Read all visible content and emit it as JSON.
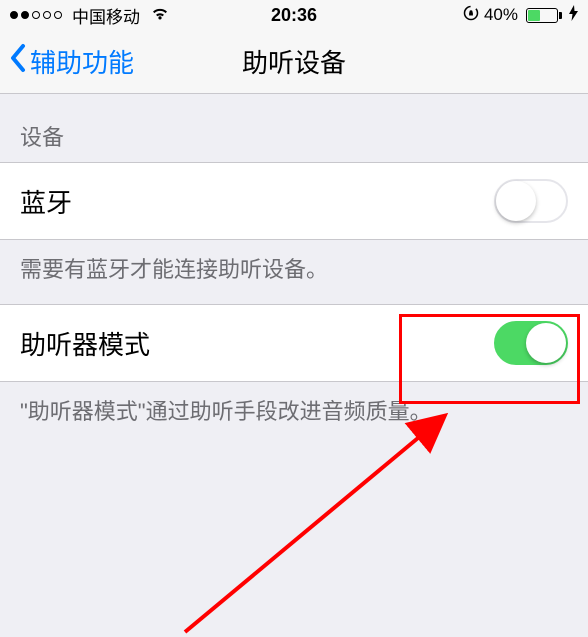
{
  "status": {
    "carrier": "中国移动",
    "time": "20:36",
    "battery_pct": "40%"
  },
  "nav": {
    "back_label": "辅助功能",
    "title": "助听设备"
  },
  "section1": {
    "header": "设备",
    "bluetooth_label": "蓝牙",
    "bluetooth_on": false,
    "footer": "需要有蓝牙才能连接助听设备。"
  },
  "section2": {
    "hearing_mode_label": "助听器模式",
    "hearing_mode_on": true,
    "footer": "\"助听器模式\"通过助听手段改进音频质量。"
  }
}
